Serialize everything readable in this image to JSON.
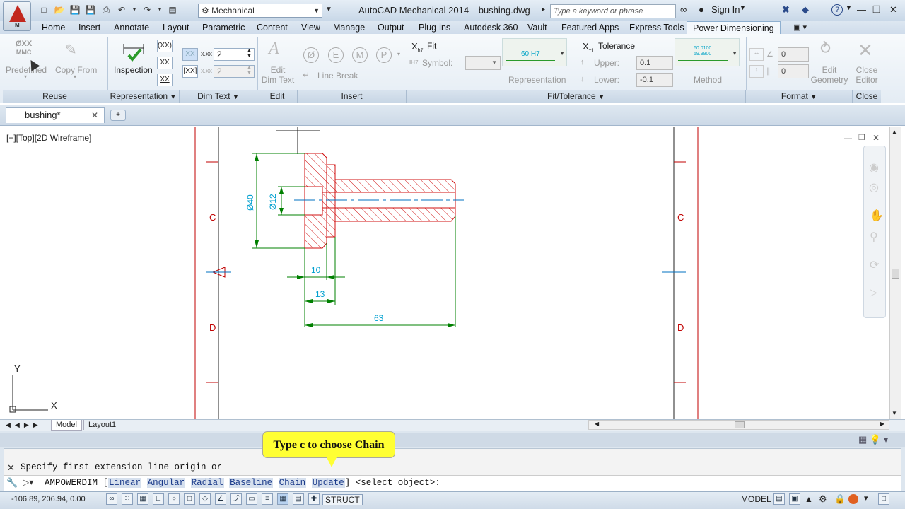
{
  "titlebar": {
    "workspace": "Mechanical",
    "app_name": "AutoCAD Mechanical 2014",
    "file_name": "bushing.dwg",
    "search_placeholder": "Type a keyword or phrase",
    "sign_in": "Sign In",
    "logo_letter": "M"
  },
  "menu_tabs": [
    "Home",
    "Insert",
    "Annotate",
    "Layout",
    "Parametric",
    "Content",
    "View",
    "Manage",
    "Output",
    "Plug-ins",
    "Autodesk 360",
    "Vault",
    "Featured Apps",
    "Express Tools",
    "Power Dimensioning"
  ],
  "ribbon": {
    "reuse": {
      "title": "Reuse",
      "predefined": "Predefined",
      "copy_from": "Copy From",
      "icon_top": "ØXX",
      "icon_bottom": "MMC"
    },
    "representation": {
      "title": "Representation",
      "inspection": "Inspection",
      "box1": "(XX)",
      "box2": "XX",
      "box3": "XX"
    },
    "dim_text": {
      "title": "Dim Text",
      "value1": "2",
      "value2": "2",
      "prefix1": "x.xx",
      "icon1": "XX",
      "icon2": "[XX]"
    },
    "edit": {
      "title": "Edit",
      "edit_dim_text_line1": "Edit",
      "edit_dim_text_line2": "Dim Text"
    },
    "insert": {
      "title": "Insert",
      "symbols": [
        "Ø",
        "E",
        "M",
        "P"
      ],
      "line_break": "Line Break"
    },
    "fit_tolerance": {
      "title": "Fit/Tolerance",
      "fit": "Fit",
      "symbol_label": "Symbol:",
      "representation_label": "Representation",
      "representation_preview": "60 H7",
      "tolerance": "Tolerance",
      "upper_label": "Upper:",
      "upper_value": "0.1",
      "lower_label": "Lower:",
      "lower_value": "-0.1",
      "method_label": "Method",
      "method_top": "60.0100",
      "method_bottom": "59.9900"
    },
    "format": {
      "title": "Format",
      "value1": "0",
      "value2": "0",
      "edit_geometry_line1": "Edit",
      "edit_geometry_line2": "Geometry"
    },
    "close": {
      "title": "Close",
      "close_editor_line1": "Close",
      "close_editor_line2": "Editor"
    }
  },
  "document_tab": "bushing*",
  "viewport_label": "[−][Top][2D Wireframe]",
  "drawing": {
    "dims": [
      "Ø40",
      "Ø12",
      "10",
      "13",
      "63"
    ],
    "zone_labels": [
      "C",
      "D",
      "C",
      "D"
    ],
    "ucs_y": "Y",
    "ucs_x": "X",
    "colors": {
      "section": "#d01010",
      "dimension": "#00a0d0",
      "extension": "#008000",
      "centerline": "#0070c0",
      "border": "#c00000"
    }
  },
  "layout_tabs": [
    "Model",
    "Layout1"
  ],
  "command": {
    "history": "Specify first extension line origin or",
    "prompt": "AMPOWERDIM",
    "options": [
      "Linear",
      "Angular",
      "Radial",
      "Baseline",
      "Chain",
      "Update"
    ],
    "tail": "<select object>:",
    "tooltip": "Type c to choose Chain"
  },
  "status": {
    "coords": "-106.89, 206.94, 0.00",
    "struct": "STRUCT",
    "model": "MODEL"
  }
}
